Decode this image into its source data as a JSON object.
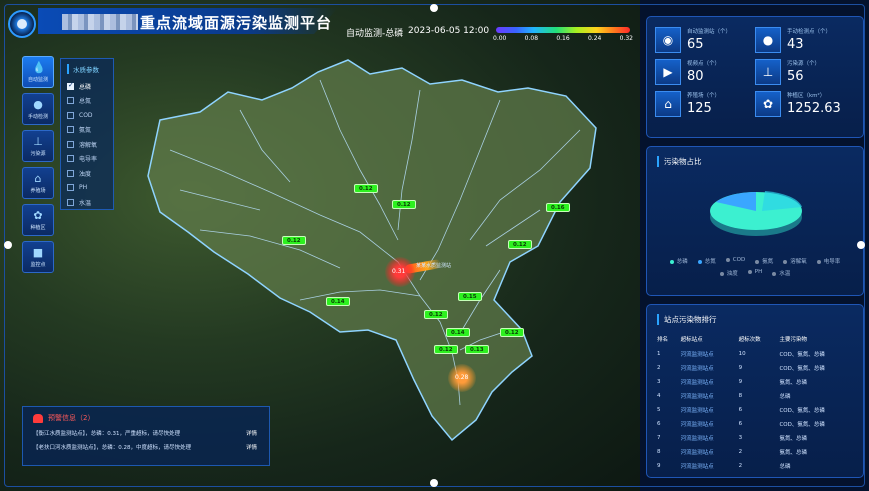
{
  "header": {
    "title": "重点流域面源污染监测平台",
    "mode_label": "自动监测-总磷",
    "datetime": "2023-06-05 12:00",
    "scale_ticks": [
      "0.00",
      "0.08",
      "0.16",
      "0.24",
      "0.32"
    ]
  },
  "sidebar": {
    "items": [
      {
        "label": "自动监测",
        "icon": "water-drop-icon",
        "active": true
      },
      {
        "label": "手动检测",
        "icon": "drop-icon",
        "active": false
      },
      {
        "label": "污染源",
        "icon": "faucet-icon",
        "active": false
      },
      {
        "label": "养殖场",
        "icon": "farm-icon",
        "active": false
      },
      {
        "label": "种植区",
        "icon": "plant-icon",
        "active": false
      },
      {
        "label": "监控点",
        "icon": "camera-icon",
        "active": false
      }
    ]
  },
  "params": {
    "title": "水质参数",
    "items": [
      {
        "label": "总磷",
        "checked": true
      },
      {
        "label": "总氮",
        "checked": false
      },
      {
        "label": "COD",
        "checked": false
      },
      {
        "label": "氨氮",
        "checked": false
      },
      {
        "label": "溶解氧",
        "checked": false
      },
      {
        "label": "电导率",
        "checked": false
      },
      {
        "label": "浊度",
        "checked": false
      },
      {
        "label": "PH",
        "checked": false
      },
      {
        "label": "水温",
        "checked": false
      }
    ]
  },
  "map": {
    "stations": [
      "0.12",
      "0.12",
      "0.16",
      "0.12",
      "0.12",
      "0.14",
      "0.15",
      "0.12",
      "0.14",
      "0.12",
      "0.12",
      "0.13"
    ],
    "hotspots": [
      "0.31",
      "0.28"
    ],
    "river_label": "某某水质监测站",
    "colors": {
      "station": "#2df01f",
      "hot_red": "#ff3a3a",
      "hot_orange": "#ff9b3a"
    }
  },
  "alarm": {
    "title": "预警信息（2）",
    "rows": [
      {
        "text": "【衡江水质监测站点】，总磷：0.31，严重超标，请尽快处理",
        "action": "详情"
      },
      {
        "text": "【老扶口河水质监测站点】，总磷：0.28，中度超标，请尽快处理",
        "action": "详情"
      }
    ]
  },
  "stats": [
    {
      "label": "自动监测站（个）",
      "value": "65",
      "icon": "station-icon"
    },
    {
      "label": "手动检测点（个）",
      "value": "43",
      "icon": "drop-icon"
    },
    {
      "label": "视频点（个）",
      "value": "80",
      "icon": "video-icon"
    },
    {
      "label": "污染源（个）",
      "value": "56",
      "icon": "faucet-icon"
    },
    {
      "label": "养殖场（个）",
      "value": "125",
      "icon": "farm-icon"
    },
    {
      "label": "种植区（km²）",
      "value": "1252.63",
      "icon": "plant-icon"
    }
  ],
  "pollutant_share": {
    "title": "污染物占比",
    "legend": [
      "总磷",
      "总氮",
      "COD",
      "氨氮",
      "溶解氧",
      "电导率",
      "浊度",
      "PH",
      "水温"
    ],
    "colors": {
      "major": "#3cf0d0",
      "minor": "#3aa6ff"
    }
  },
  "ranking": {
    "title": "站点污染物排行",
    "columns": [
      "排名",
      "超标站点",
      "超标次数",
      "主要污染物"
    ],
    "rows": [
      [
        "1",
        "河流监测站点",
        "10",
        "COD、氨氮、总磷"
      ],
      [
        "2",
        "河流监测站点",
        "9",
        "COD、氨氮、总磷"
      ],
      [
        "3",
        "河流监测站点",
        "9",
        "氨氮、总磷"
      ],
      [
        "4",
        "河流监测站点",
        "8",
        "总磷"
      ],
      [
        "5",
        "河流监测站点",
        "6",
        "COD、氨氮、总磷"
      ],
      [
        "6",
        "河流监测站点",
        "6",
        "COD、氨氮、总磷"
      ],
      [
        "7",
        "河流监测站点",
        "3",
        "氨氮、总磷"
      ],
      [
        "8",
        "河流监测站点",
        "2",
        "氨氮、总磷"
      ],
      [
        "9",
        "河流监测站点",
        "2",
        "总磷"
      ]
    ]
  }
}
